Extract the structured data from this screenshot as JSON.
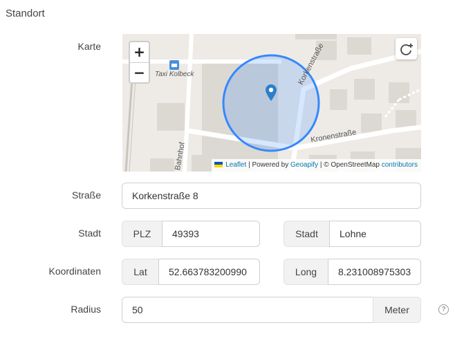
{
  "section": {
    "title": "Standort"
  },
  "labels": {
    "map": "Karte",
    "street": "Straße",
    "city": "Stadt",
    "coordinates": "Koordinaten",
    "radius": "Radius"
  },
  "map": {
    "zoom_in": "+",
    "zoom_out": "−",
    "poi_label": "Taxi Kolbeck",
    "streets": [
      "Korkenstraße",
      "Kronenstraße",
      "Bahnhof"
    ],
    "attribution": {
      "leaflet": "Leaflet",
      "powered_by": "| Powered by",
      "geoapify": "Geoapify",
      "osm": "| © OpenStreetMap",
      "contributors": "contributors"
    },
    "circle_color": "#3388ff"
  },
  "form": {
    "street_value": "Korkenstraße 8",
    "plz_label": "PLZ",
    "plz_value": "49393",
    "city_label": "Stadt",
    "city_value": "Lohne",
    "lat_label": "Lat",
    "lat_value": "52.663783200990",
    "long_label": "Long",
    "long_value": "8.231008975303",
    "radius_value": "50",
    "radius_unit": "Meter"
  },
  "icons": [
    "zoom-in-icon",
    "zoom-out-icon",
    "locate-icon",
    "map-marker-icon",
    "taxi-icon",
    "help-icon"
  ]
}
